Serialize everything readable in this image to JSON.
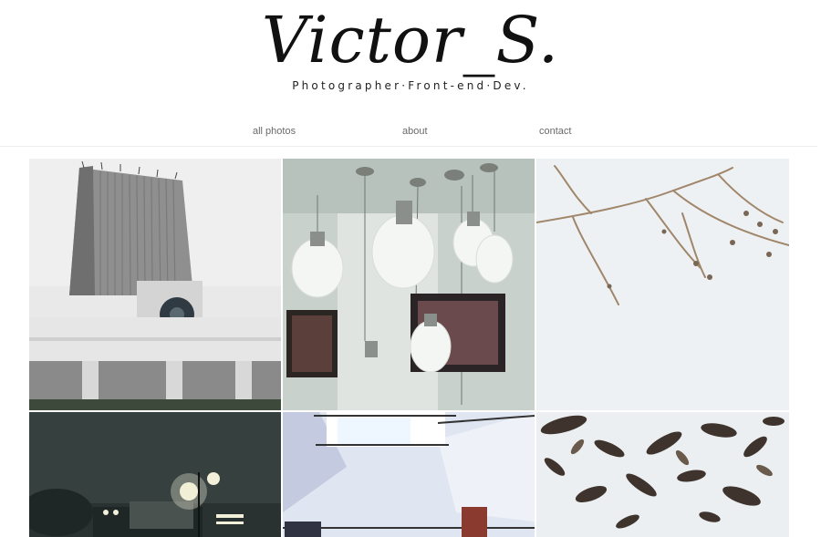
{
  "header": {
    "logo": "Victor_S.",
    "tagline": "Photographer·Front-end·Dev."
  },
  "nav": {
    "items": [
      "all photos",
      "about",
      "contact"
    ]
  },
  "gallery": {
    "photos": [
      "tower-building-photo",
      "lightbulb-lamps-photo",
      "dry-branch-photo",
      "night-street-lamp-photo",
      "stairwell-interior-photo",
      "leaves-on-snow-photo"
    ]
  },
  "colors": {
    "nav_text": "#6a6a6a",
    "logo": "#111111",
    "divider": "#ededed"
  }
}
